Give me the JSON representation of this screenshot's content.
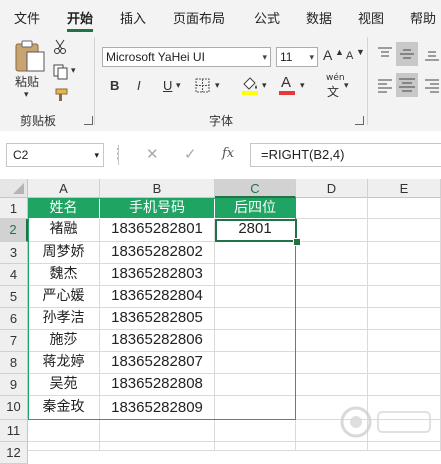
{
  "tabs": [
    "文件",
    "开始",
    "插入",
    "页面布局",
    "公式",
    "数据",
    "视图",
    "帮助"
  ],
  "ribbon": {
    "paste_label": "粘贴",
    "clipboard_group": "剪贴板",
    "font_group": "字体",
    "font_name": "Microsoft YaHei UI",
    "font_size": "11",
    "bold": "B",
    "italic": "I",
    "underline": "U",
    "font_color_glyph": "A",
    "phonetic_glyph": "wén",
    "phonetic_small": "文",
    "font_size_up": "A",
    "font_size_down": "A"
  },
  "formula_bar": {
    "name_box": "C2",
    "fx_label": "fx",
    "formula": "=RIGHT(B2,4)"
  },
  "grid": {
    "columns": [
      "A",
      "B",
      "C",
      "D",
      "E"
    ],
    "row_numbers": [
      "1",
      "2",
      "3",
      "4",
      "5",
      "6",
      "7",
      "8",
      "9",
      "10",
      "11",
      "12"
    ],
    "header_row": [
      "姓名",
      "手机号码",
      "后四位"
    ],
    "rows": [
      {
        "name": "褚融",
        "phone": "18365282801",
        "last4": "2801"
      },
      {
        "name": "周梦娇",
        "phone": "18365282802",
        "last4": ""
      },
      {
        "name": "魏杰",
        "phone": "18365282803",
        "last4": ""
      },
      {
        "name": "严心媛",
        "phone": "18365282804",
        "last4": ""
      },
      {
        "name": "孙孝洁",
        "phone": "18365282805",
        "last4": ""
      },
      {
        "name": "施莎",
        "phone": "18365282806",
        "last4": ""
      },
      {
        "name": "蒋龙婷",
        "phone": "18365282807",
        "last4": ""
      },
      {
        "name": "吴苑",
        "phone": "18365282808",
        "last4": ""
      },
      {
        "name": "秦金玫",
        "phone": "18365282809",
        "last4": ""
      }
    ],
    "selected_cell": "C2"
  },
  "colors": {
    "accent": "#217346",
    "table_header": "#1fa463"
  }
}
